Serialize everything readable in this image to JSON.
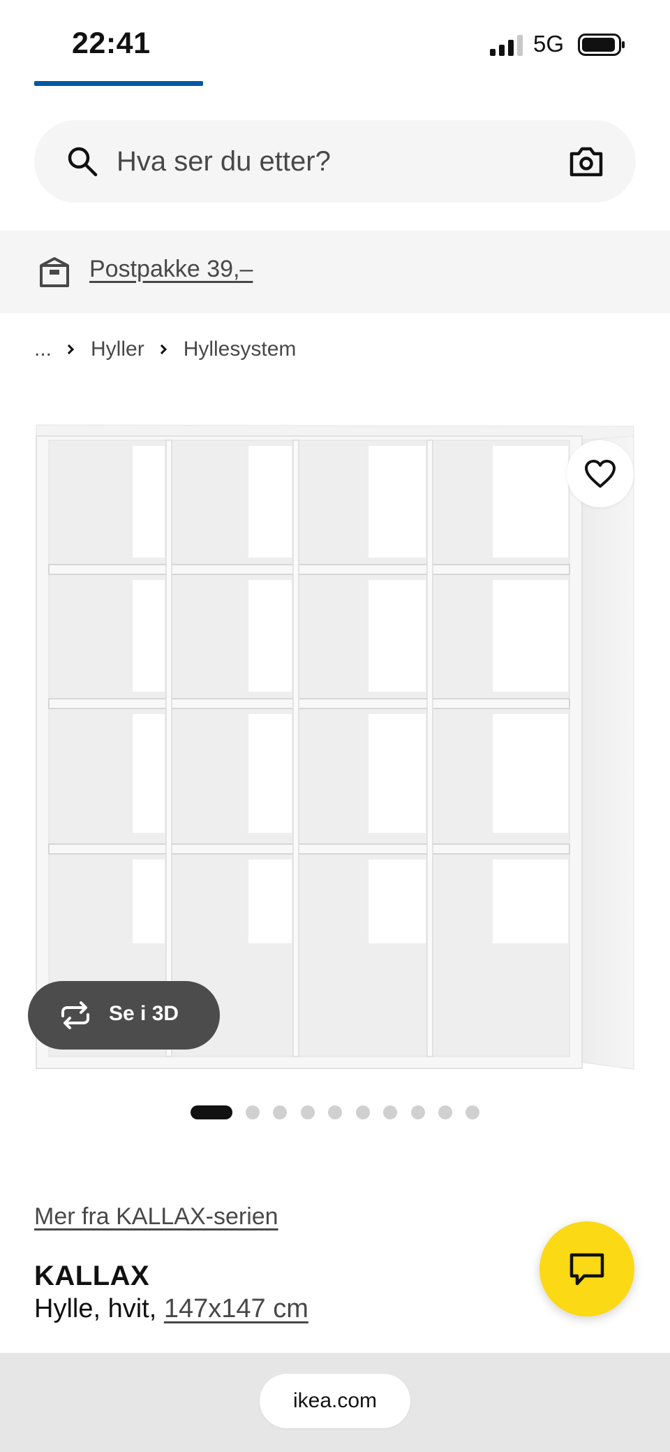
{
  "status_bar": {
    "time": "22:41",
    "network": "5G"
  },
  "search": {
    "placeholder": "Hva ser du etter?"
  },
  "banner": {
    "link_text": "Postpakke 39,–"
  },
  "breadcrumb": {
    "items": [
      "...",
      "Hyller",
      "Hyllesystem"
    ]
  },
  "gallery": {
    "view_3d_label": "Se i 3D",
    "image_count": 10,
    "active_index": 0
  },
  "product": {
    "series_link": "Mer fra KALLAX-serien",
    "name": "KALLAX",
    "description": "Hylle, hvit,",
    "size": "147x147 cm"
  },
  "browser": {
    "url": "ikea.com"
  },
  "colors": {
    "brand_blue": "#0058a3",
    "chat_yellow": "#fbd914",
    "banner_bg": "#f5f5f5"
  },
  "icons": [
    "search-icon",
    "camera-icon",
    "box-icon",
    "heart-icon",
    "rotate-3d-icon",
    "chat-icon",
    "signal-icon",
    "battery-icon"
  ]
}
